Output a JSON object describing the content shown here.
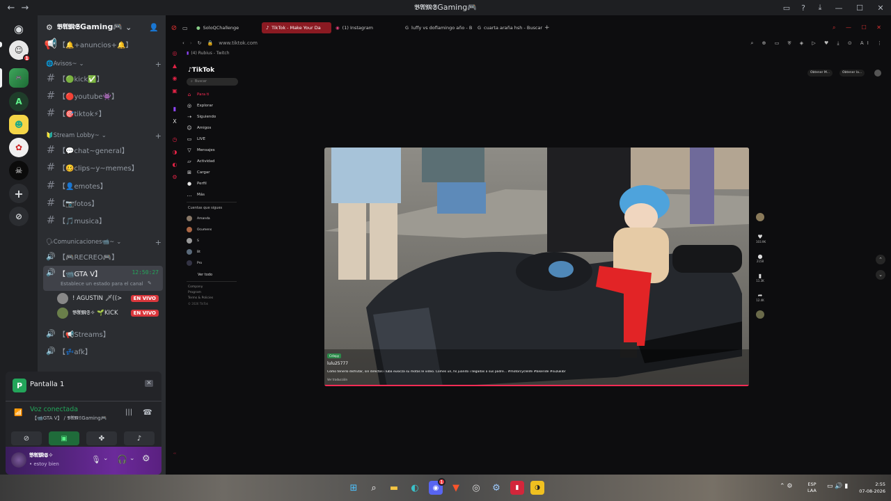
{
  "window": {
    "title": "𝕭𝕬𝕸𝕾Gaming🎮",
    "back": "←",
    "forward": "→"
  },
  "server_rail": {
    "home_badge": "1",
    "items": [
      "discord-home",
      "avatar-server",
      "gaming-server",
      "a-server",
      "smiley-server",
      "red-server",
      "joker-server",
      "add-server",
      "explore-server"
    ]
  },
  "server_header": {
    "name": "𝕭𝕬𝕸𝕾Gaming🎮"
  },
  "channels": {
    "top_partial": "【🔔+anuncios+🔔】",
    "cat_avisos": "🌐Avisos~",
    "kick": "【🟢kick✅】",
    "youtube": "【🔴youtube👾】",
    "tiktok": "【🎯tiktok⚡】",
    "cat_stream": "🔰Stream Lobby~",
    "chat": "【💬chat~general】",
    "clips": "【🥴clips~y~memes】",
    "emotes": "【👤emotes】",
    "fotos": "【📷fotos】",
    "musica": "【🎵musica】",
    "cat_comms": "🗣Comunicaciones📹~",
    "recreo": "【🎮RECREO🎮】",
    "gtav": "【📹GTA V】",
    "gtav_time": "12:50:27",
    "gtav_status": "Establece un estado para el canal",
    "user1": "! AGUSTIN 🗡((>",
    "user2": "𝕭𝕬𝕸𝕾✧ 🌱KICK",
    "live_label": "EN VIVO",
    "streams": "【📢Streams】",
    "afk": "【💤afk】"
  },
  "screen_panel": {
    "title": "Pantalla 1",
    "voice_status": "Voz conectada",
    "voice_channel": "【📹GTA V】 / 𝕭𝕬𝕸𝕾Gaming🎮"
  },
  "user": {
    "name": "𝕭𝕬𝕸𝕾✧",
    "status": "• estoy bien"
  },
  "browser": {
    "tabs": [
      "SoloQChallenge",
      "TikTok - Make Your Da",
      "(1) Instagram",
      "luffy vs doflamingo año - B",
      "cuarta araña hsh - Buscar"
    ],
    "url": "www.tiktok.com",
    "twitch_tab": "(4) Rubius - Twitch"
  },
  "tiktok": {
    "logo": "TikTok",
    "search_placeholder": "Buscar",
    "nav": [
      "Para ti",
      "Explorar",
      "Siguiendo",
      "Amigos",
      "LIVE",
      "Mensajes",
      "Actividad",
      "Cargar",
      "Perfil",
      "Más"
    ],
    "following_header": "Cuentas que sigues",
    "accounts": [
      "Amanda",
      "Ocumens",
      "S",
      "Bt",
      "Pro"
    ],
    "see_all": "Ver todo",
    "footer": [
      "Company",
      "Program",
      "Terms & Policies",
      "© 2026 TikTok"
    ],
    "top_buttons": [
      "Obtener M...",
      "Obtener la..."
    ],
    "video_user": "lulu25777",
    "video_caption": "Cómo tenerlo disfrutar, sin directos i luba eusicza su motas le video. Comes un, hs juanito i llegadas a sus padre... #motorcyclelife #bikeride #suzukibr",
    "video_translate": "Ver traducción",
    "tag": "Créepy",
    "counts": [
      "103.9K",
      "2158",
      "11.3K",
      "12.4K"
    ]
  },
  "taskbar": {
    "lang": "ESP",
    "lang2": "LAA",
    "time": "2:55",
    "date": "07-08-2026",
    "discord_badge": "1"
  }
}
